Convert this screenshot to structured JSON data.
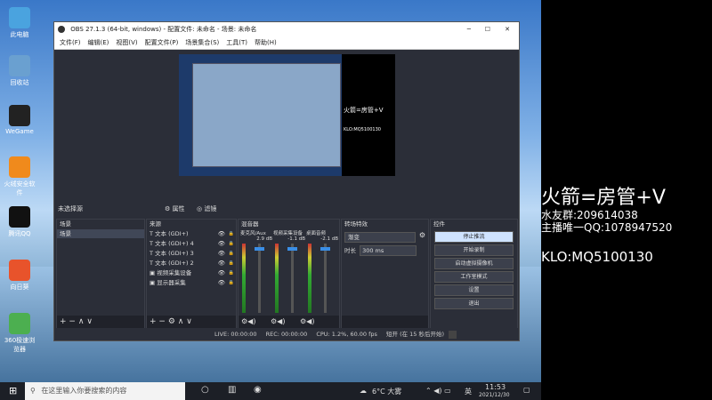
{
  "desktop_icons": [
    {
      "label": "此电脑",
      "color": "#4aa3df"
    },
    {
      "label": "回收站",
      "color": "#6aa0d0"
    },
    {
      "label": "WeGame",
      "color": "#222"
    },
    {
      "label": "火绒安全软件",
      "color": "#f08a1c"
    },
    {
      "label": "腾讯QQ",
      "color": "#111"
    },
    {
      "label": "向日葵",
      "color": "#e8532b"
    },
    {
      "label": "360极速浏览器",
      "color": "#4caf50"
    }
  ],
  "obs": {
    "title": "OBS 27.1.3 (64-bit, windows) - 配置文件: 未命名 - 场景: 未命名",
    "menu": [
      "文件(F)",
      "编辑(E)",
      "视图(V)",
      "配置文件(P)",
      "场景集合(S)",
      "工具(T)",
      "帮助(H)"
    ],
    "scene_bar": {
      "label": "未选择源",
      "properties": "属性",
      "filters": "滤镜"
    },
    "docks": {
      "scenes": {
        "title": "场景",
        "items": [
          "场景"
        ]
      },
      "sources": {
        "title": "来源",
        "items": [
          "文本 (GDI+)",
          "文本 (GDI+) 4",
          "文本 (GDI+) 3",
          "文本 (GDI+) 2",
          "视频采集设备",
          "显示器采集"
        ]
      },
      "mixer": {
        "title": "混音器",
        "channels": [
          {
            "name": "麦克风/Aux",
            "db": "2.9 dB"
          },
          {
            "name": "视频采集设备",
            "db": "-1.1 dB"
          },
          {
            "name": "桌面音频",
            "db": "-2.1 dB"
          }
        ]
      },
      "transitions": {
        "title": "转场特效",
        "mode": "渐变",
        "duration_label": "时长",
        "duration": "300 ms"
      },
      "controls": {
        "title": "控件",
        "buttons": [
          "停止推流",
          "开始录制",
          "启动虚拟摄像机",
          "工作室模式",
          "设置",
          "退出"
        ]
      }
    },
    "status": {
      "live": "LIVE: 00:00:00",
      "rec": "REC: 00:00:00",
      "cpu": "CPU: 1.2%, 60.00 fps",
      "reconnect": "短开 (在 15 秒后开始)"
    }
  },
  "overlay": {
    "line1": "火箭=房管+V",
    "line2": "水友群:209614038",
    "line3": "主播唯一QQ:1078947520",
    "line4": "KLO:MQ5100130"
  },
  "preview_overlay": {
    "line1": "火箭=房管+V",
    "line2": "KLO:MQ5100130"
  },
  "taskbar": {
    "search_placeholder": "在这里输入你要搜索的内容",
    "weather": "6°C 大雾",
    "ime": "英",
    "time": "11:53",
    "date": "2021/12/30"
  }
}
